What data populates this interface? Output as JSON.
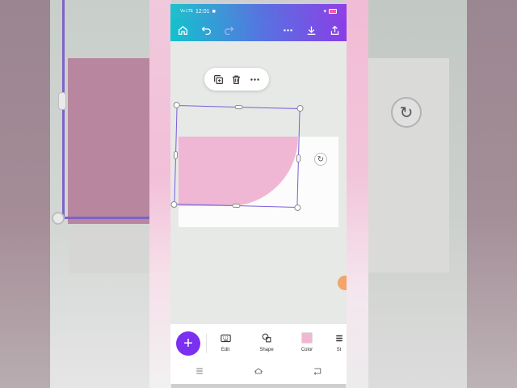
{
  "status_bar": {
    "time": "12:01",
    "network": "Vo LTE",
    "battery_color": "#ff58a0"
  },
  "toolbar": {
    "icons": [
      "home-icon",
      "undo-icon",
      "redo-icon",
      "more-icon",
      "download-icon",
      "share-icon"
    ]
  },
  "context_menu": {
    "icons": [
      "duplicate-icon",
      "trash-icon",
      "more-horizontal-icon"
    ]
  },
  "canvas": {
    "shape_color": "#f0b7d4",
    "selection_color": "#7d5cd8"
  },
  "bottom_toolbar": {
    "add_label": "+",
    "tools": [
      {
        "label": "Edit",
        "icon": "keyboard-icon"
      },
      {
        "label": "Shape",
        "icon": "shapes-icon"
      },
      {
        "label": "Color",
        "icon": "color-swatch"
      },
      {
        "label": "St",
        "icon": "font-icon"
      }
    ]
  },
  "navigation": {
    "icons": [
      "menu-icon",
      "home-nav-icon",
      "back-icon"
    ]
  },
  "colors": {
    "accent": "#7b2ff0",
    "header_gradient_start": "#13c2cd",
    "header_gradient_end": "#8a3ee6"
  }
}
